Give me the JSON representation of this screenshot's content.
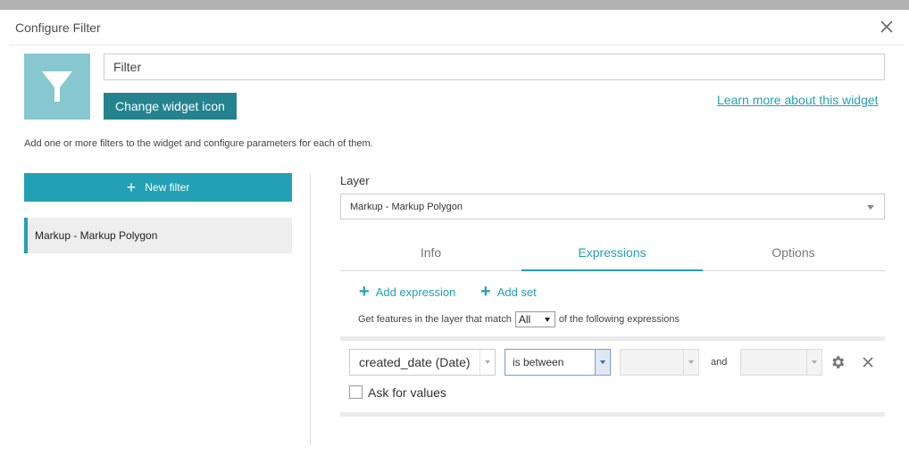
{
  "dialog": {
    "title": "Configure Filter"
  },
  "widget": {
    "name_value": "Filter",
    "change_icon_label": "Change widget icon",
    "learn_more_label": "Learn more about this widget",
    "icon": "filter-funnel-icon",
    "icon_bg_color": "#86c7d0"
  },
  "description": "Add one or more filters to the widget and configure parameters for each of them.",
  "filters": {
    "new_filter_label": "New filter",
    "items": [
      {
        "label": "Markup - Markup Polygon",
        "selected": true
      }
    ]
  },
  "layer": {
    "label": "Layer",
    "selected": "Markup - Markup Polygon"
  },
  "tabs": [
    {
      "label": "Info",
      "active": false
    },
    {
      "label": "Expressions",
      "active": true
    },
    {
      "label": "Options",
      "active": false
    }
  ],
  "expressions": {
    "add_expression_label": "Add expression",
    "add_set_label": "Add set",
    "match_prefix": "Get features in the layer that match",
    "match_value": "All",
    "match_suffix": "of the following expressions",
    "rows": [
      {
        "field": "created_date (Date)",
        "operator": "is between",
        "value1": "",
        "joiner": "and",
        "value2": "",
        "ask_for_values_label": "Ask for values",
        "ask_for_values": false
      }
    ]
  },
  "colors": {
    "accent": "#24a0b5",
    "accent_dark": "#24838f",
    "topbar": "#b3b3b3"
  }
}
